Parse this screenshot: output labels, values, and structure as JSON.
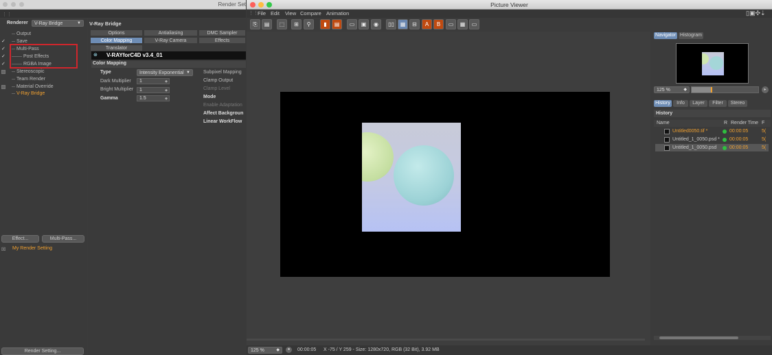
{
  "render_settings": {
    "title": "Render Set",
    "renderer_label": "Renderer",
    "renderer_value": "V-Ray Bridge",
    "tree": [
      {
        "label": "Output",
        "check": ""
      },
      {
        "label": "Save",
        "check": "✓"
      },
      {
        "label": "Multi-Pass",
        "check": "✓"
      },
      {
        "label": "Post Effects",
        "check": "✓"
      },
      {
        "label": "RGBA Image",
        "check": "✓"
      },
      {
        "label": "Stereoscopic",
        "check": ""
      },
      {
        "label": "Team Render",
        "check": ""
      },
      {
        "label": "Material Override",
        "check": ""
      },
      {
        "label": "V-Ray Bridge",
        "check": ""
      }
    ],
    "effect_button": "Effect...",
    "multipass_button": "Multi-Pass...",
    "preset_label": "My Render Setting",
    "render_setting_button": "Render Setting...",
    "panel_title": "V-Ray Bridge",
    "tabs_row1": [
      "Options",
      "Antialiasing",
      "DMC Sampler"
    ],
    "tabs_row2": [
      "Color Mapping",
      "V-Ray Camera",
      "Effects"
    ],
    "tab_translator": "Translator",
    "banner_text": "V-RAYforC4D  v3.4_01",
    "section_title": "Color Mapping",
    "type_label": "Type",
    "type_value": "Intensity Exponential",
    "dark_label": "Dark Multiplier",
    "dark_value": "1",
    "bright_label": "Bright Multiplier",
    "bright_value": "1",
    "gamma_label": "Gamma",
    "gamma_value": "1.5",
    "subpixel_label": "Subpixel Mapping",
    "clamp_output_label": "Clamp Output",
    "clamp_level_label": "Clamp Level",
    "mode_label": "Mode",
    "enable_adapt_label": "Enable Adaptation",
    "affect_bg_label": "Affect Backgroun",
    "linear_wf_label": "Linear WorkFlow"
  },
  "picture_viewer": {
    "title": "Picture Viewer",
    "menu": [
      "File",
      "Edit",
      "View",
      "Compare",
      "Animation"
    ],
    "side_tabs_top": [
      "Navigator",
      "Histogram"
    ],
    "zoom": "125 %",
    "side_tabs_bottom": [
      "History",
      "Info",
      "Layer",
      "Filter",
      "Stereo"
    ],
    "history_title": "History",
    "history_cols": {
      "name": "Name",
      "r": "R",
      "time": "Render Time",
      "f": "F"
    },
    "history_rows": [
      {
        "name": "Untitled0050.tif *",
        "time": "00:00:05",
        "f": "5("
      },
      {
        "name": "Untitled_1_0050.psd *",
        "time": "00:00:05",
        "f": "5("
      },
      {
        "name": "Untitled_1_0050.psd",
        "time": "00:00:05",
        "f": "5("
      }
    ],
    "status_zoom": "125 %",
    "status_time": "00:00:05",
    "status_info": "X -75 / Y 259 - Size: 1280x720, RGB (32 Bit), 3.92 MB",
    "colors": {
      "accent": "#6e8db5",
      "orange": "#f0a030",
      "highlight": "#d0262c",
      "status_ok": "#2fbf3f"
    }
  }
}
